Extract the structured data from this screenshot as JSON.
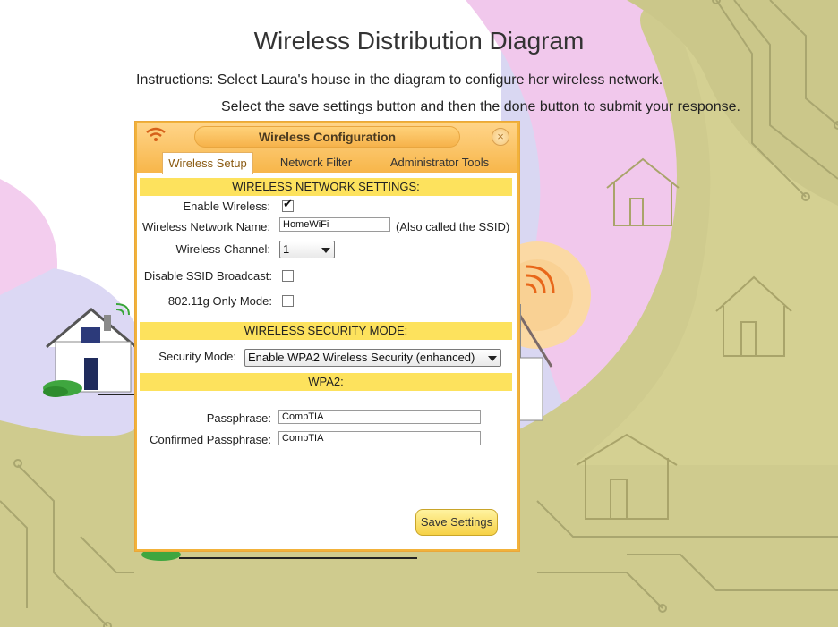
{
  "page": {
    "title": "Wireless Distribution Diagram",
    "instruction_line1": "Instructions: Select Laura's house in the diagram to configure her wireless network.",
    "instruction_line2": "Select the save settings button and then the done button to submit your response."
  },
  "dialog": {
    "title": "Wireless Configuration",
    "close_label": "×",
    "tabs": [
      {
        "label": "Wireless Setup",
        "active": true
      },
      {
        "label": "Network Filter",
        "active": false
      },
      {
        "label": "Administrator Tools",
        "active": false
      }
    ],
    "network_settings": {
      "header": "WIRELESS NETWORK SETTINGS:",
      "enable_wireless_label": "Enable Wireless:",
      "enable_wireless_checked": true,
      "network_name_label": "Wireless Network Name:",
      "network_name_value": "HomeWiFi",
      "network_name_hint": "(Also called the SSID)",
      "channel_label": "Wireless Channel:",
      "channel_value": "1",
      "disable_ssid_label": "Disable SSID Broadcast:",
      "disable_ssid_checked": false,
      "g_only_label": "802.11g Only Mode:",
      "g_only_checked": false
    },
    "security": {
      "header": "WIRELESS SECURITY MODE:",
      "mode_label": "Security Mode:",
      "mode_value": "Enable WPA2 Wireless Security (enhanced)"
    },
    "wpa2": {
      "header": "WPA2:",
      "passphrase_label": "Passphrase:",
      "passphrase_value": "CompTIA",
      "confirm_label": "Confirmed Passphrase:",
      "confirm_value": "CompTIA"
    },
    "save_label": "Save Settings"
  },
  "colors": {
    "dialog_header": "#f7b64a",
    "section_bar": "#fde25d",
    "accent_border": "#f2b23a",
    "background_olive": "#cfcb8e",
    "background_pink": "#f3c9ee",
    "background_lavender": "#d7d5f4"
  }
}
